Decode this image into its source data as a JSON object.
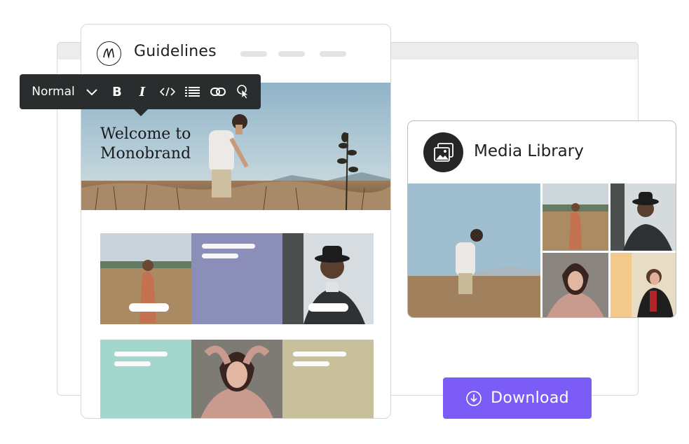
{
  "guidelines": {
    "title": "Guidelines",
    "hero_title_line1": "Welcome to",
    "hero_title_line2": "Monobrand",
    "tile_colors": {
      "lavender": "#8c8eba",
      "mint": "#a3d6cc",
      "khaki": "#c8c09a"
    }
  },
  "toolbar": {
    "style_label": "Normal",
    "icons": [
      "chevron-down-icon",
      "bold-icon",
      "italic-icon",
      "code-icon",
      "list-icon",
      "link-icon",
      "cursor-click-icon"
    ],
    "bold_glyph": "B",
    "italic_glyph": "I"
  },
  "media_library": {
    "title": "Media Library",
    "icon": "image-gallery-icon"
  },
  "download": {
    "label": "Download",
    "icon": "download-circle-icon",
    "color": "#7c5cf7"
  }
}
